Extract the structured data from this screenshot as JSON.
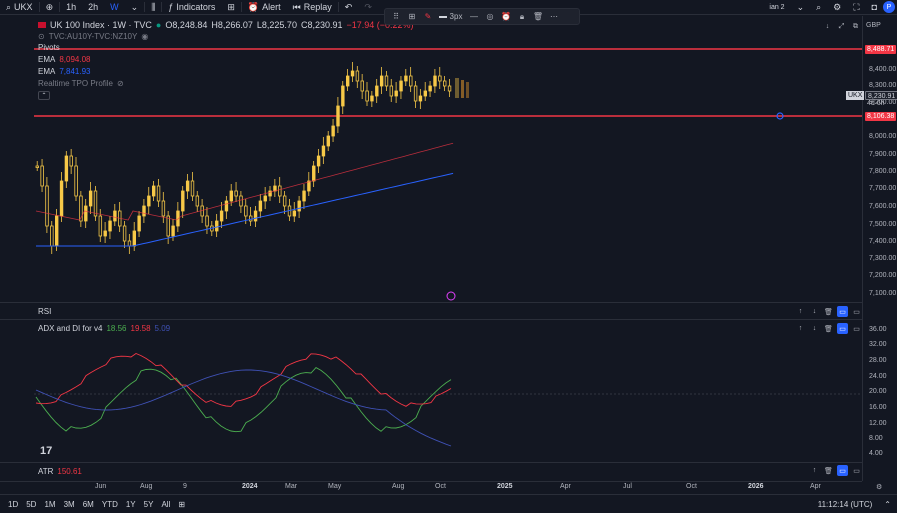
{
  "topbar": {
    "symbol": "UKX",
    "intervals": [
      "1h",
      "2h",
      "W"
    ],
    "active_interval": "W",
    "indicators_label": "Indicators",
    "alert_label": "Alert",
    "replay_label": "Replay",
    "layout_name": "ian 2"
  },
  "draw_toolbar": {
    "stroke_label": "3px"
  },
  "main_pane": {
    "title": "UK 100 Index · 1W · TVC",
    "ohlc": {
      "o": "O8,248.84",
      "h": "H8,266.07",
      "l": "L8,225.70",
      "c": "C8,230.91",
      "change": "−17.94 (−0.22%)"
    },
    "compare_symbols": "TVC:AU10Y-TVC:NZ10Y",
    "indicators": [
      {
        "name": "Pivots",
        "value": ""
      },
      {
        "name": "EMA",
        "value": "8,094.08",
        "color": "#f23645"
      },
      {
        "name": "EMA",
        "value": "7,841.93",
        "color": "#2962ff"
      },
      {
        "name": "Realtime TPO Profile",
        "value": ""
      }
    ]
  },
  "price_axis": {
    "currency": "GBP",
    "ticks": [
      "8,400.00",
      "8,300.00",
      "8,200.00",
      "8,000.00",
      "7,900.00",
      "7,800.00",
      "7,700.00",
      "7,600.00",
      "7,500.00",
      "7,400.00",
      "7,300.00",
      "7,200.00",
      "7,100.00"
    ],
    "labels": {
      "pivot_high": "8,488.71",
      "last_price": "8,230.91",
      "countdown": "4d 6h",
      "symbol_tag": "UKX",
      "pivot_low": "8,106.38"
    }
  },
  "rsi_pane": {
    "title": "RSI"
  },
  "adx_pane": {
    "title": "ADX and DI for v4",
    "values": [
      "18.56",
      "19.58",
      "5.09"
    ],
    "ticks": [
      "36.00",
      "32.00",
      "28.00",
      "24.00",
      "20.00",
      "16.00",
      "12.00",
      "8.00",
      "4.00"
    ]
  },
  "atr_pane": {
    "title": "ATR",
    "value": "150.61"
  },
  "time_axis": {
    "labels": [
      "Jun",
      "Aug",
      "9",
      "2024",
      "Mar",
      "May",
      "Aug",
      "Oct",
      "2025",
      "Apr",
      "Jul",
      "Oct",
      "2026",
      "Apr"
    ]
  },
  "bottombar": {
    "ranges": [
      "1D",
      "5D",
      "1M",
      "3M",
      "6M",
      "YTD",
      "1Y",
      "5Y",
      "All"
    ],
    "clock": "11:12:14 (UTC)"
  },
  "colors": {
    "up": "#f7c948",
    "down": "#f7c948",
    "ema_fast": "#f23645",
    "ema_slow": "#2962ff",
    "pivot_line": "#f23645",
    "adx_green": "#4caf50",
    "adx_red": "#f23645",
    "adx_blue": "#3f51b5"
  }
}
